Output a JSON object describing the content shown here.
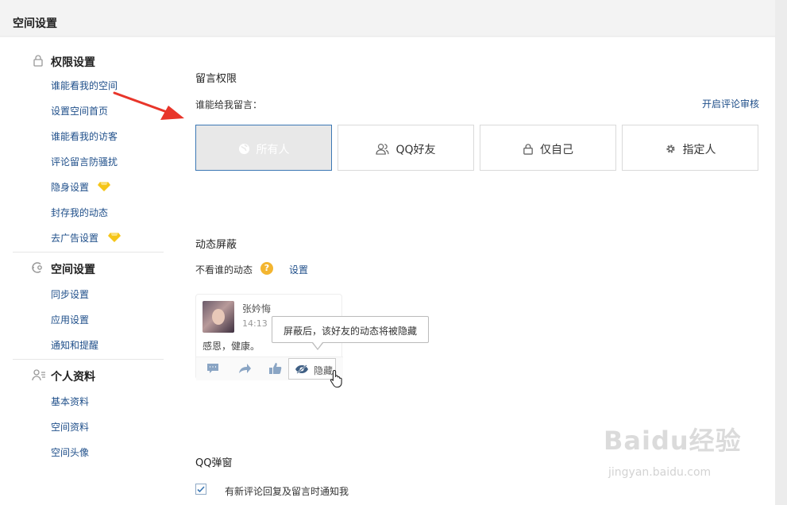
{
  "header": {
    "title": "空间设置"
  },
  "sidebar": {
    "sections": [
      {
        "label": "权限设置",
        "icon": "lock-icon",
        "items": [
          {
            "label": "谁能看我的空间"
          },
          {
            "label": "设置空间首页"
          },
          {
            "label": "谁能看我的访客"
          },
          {
            "label": "评论留言防骚扰"
          },
          {
            "label": "隐身设置",
            "badge": "diamond-icon"
          },
          {
            "label": "封存我的动态"
          },
          {
            "label": "去广告设置",
            "badge": "diamond-icon"
          }
        ]
      },
      {
        "label": "空间设置",
        "icon": "space-settings-icon",
        "items": [
          {
            "label": "同步设置"
          },
          {
            "label": "应用设置"
          },
          {
            "label": "通知和提醒"
          }
        ]
      },
      {
        "label": "个人资料",
        "icon": "profile-icon",
        "items": [
          {
            "label": "基本资料"
          },
          {
            "label": "空间资料"
          },
          {
            "label": "空间头像"
          }
        ]
      }
    ]
  },
  "message_permission": {
    "title": "留言权限",
    "question": "谁能给我留言：",
    "review_link": "开启评论审核",
    "options": [
      {
        "label": "所有人",
        "icon": "globe-icon",
        "selected": true
      },
      {
        "label": "QQ好友",
        "icon": "friends-icon",
        "selected": false
      },
      {
        "label": "仅自己",
        "icon": "lock-icon",
        "selected": false
      },
      {
        "label": "指定人",
        "icon": "gear-icon",
        "selected": false
      }
    ]
  },
  "feed_block": {
    "title": "动态屏蔽",
    "label": "不看谁的动态",
    "help_icon": "question-icon",
    "settings_link": "设置",
    "example": {
      "user_name": "张妗悔",
      "time": "14:13",
      "text": "感恩，健康。",
      "hide_label": "隐藏",
      "tooltip": "屏蔽后，该好友的动态将被隐藏"
    }
  },
  "popup": {
    "title": "QQ弹窗",
    "checkbox_label": "有新评论回复及留言时通知我",
    "checked": true
  },
  "watermark": {
    "line1": "Baidu经验",
    "line2": "jingyan.baidu.com"
  },
  "colors": {
    "link": "#1f4f8a",
    "selected_border": "#3c78b4",
    "arrow": "#e8352a",
    "diamond": "#f5c518"
  }
}
